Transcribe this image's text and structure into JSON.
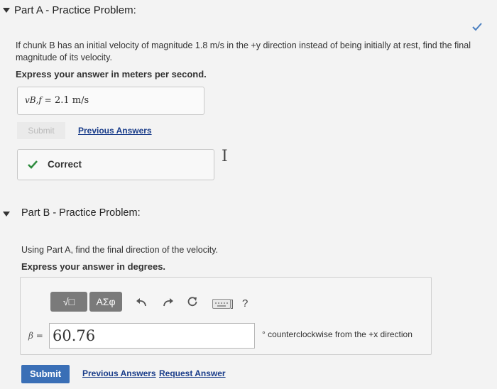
{
  "partA": {
    "title": "Part A - Practice Problem:",
    "question_line1": "If chunk B has an initial velocity of magnitude 1.8 m/s in the +y direction instead of being initially at rest, find the final",
    "question_line2": "magnitude of its velocity.",
    "instruction": "Express your answer in meters per second.",
    "answer_label": "vB,f =",
    "answer_value": "2.1 m/s",
    "submit_label": "Submit",
    "previous_answers_label": "Previous Answers",
    "feedback_label": "Correct"
  },
  "partB": {
    "title": "Part B - Practice Problem:",
    "question": "Using Part A, find the final direction of the velocity.",
    "instruction": "Express your answer in degrees.",
    "toolbar": {
      "templates_label": "√□",
      "symbols_label": "ΑΣφ",
      "help_label": "?"
    },
    "answer_label": "β =",
    "answer_value": "60.76",
    "unit_suffix": "° counterclockwise from the +x direction",
    "submit_label": "Submit",
    "previous_answers_label": "Previous Answers",
    "request_answer_label": "Request Answer"
  },
  "colors": {
    "check_green": "#2e8b3e",
    "link_blue": "#1a3d8a",
    "submit_blue": "#3a6fb6"
  }
}
